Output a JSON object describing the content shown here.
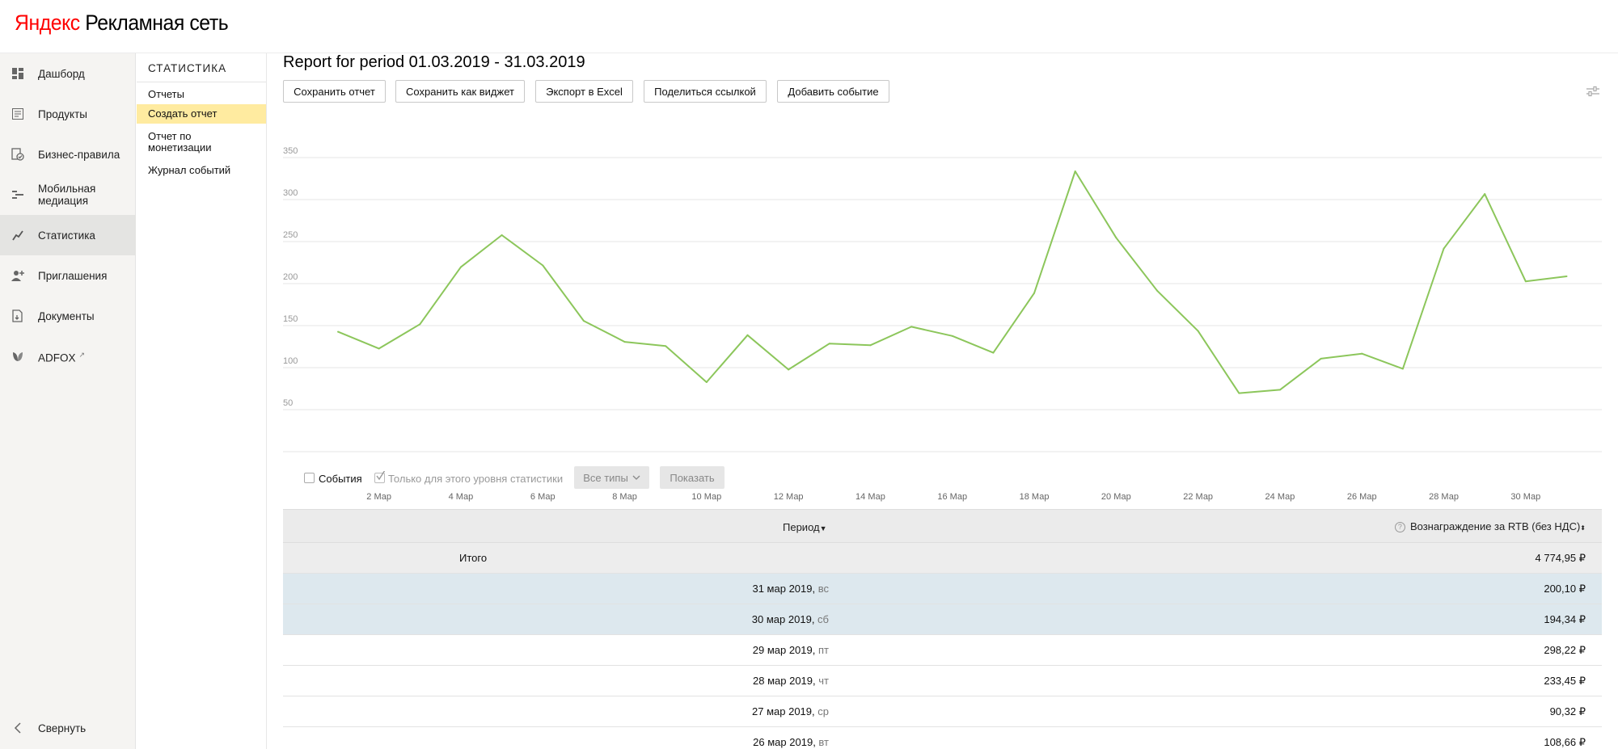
{
  "header": {
    "logo_brand": "Яндекс",
    "logo_product": "Рекламная сеть"
  },
  "sidebar": {
    "items": [
      {
        "label": "Дашборд",
        "icon": "dashboard-icon"
      },
      {
        "label": "Продукты",
        "icon": "products-icon"
      },
      {
        "label": "Бизнес-правила",
        "icon": "business-rules-icon"
      },
      {
        "label": "Мобильная медиация",
        "icon": "mediation-icon"
      },
      {
        "label": "Статистика",
        "icon": "statistics-icon",
        "active": true
      },
      {
        "label": "Приглашения",
        "icon": "invite-icon"
      },
      {
        "label": "Документы",
        "icon": "documents-icon"
      },
      {
        "label": "ADFOX",
        "icon": "adfox-icon"
      }
    ],
    "collapse_label": "Свернуть"
  },
  "subnav": {
    "title": "СТАТИСТИКА",
    "items": [
      {
        "label": "Отчеты"
      },
      {
        "label": "Создать отчет",
        "active": true
      },
      {
        "label": "Отчет по монетизации"
      },
      {
        "label": "Журнал событий"
      }
    ]
  },
  "main": {
    "title": "Report for period 01.03.2019 - 31.03.2019",
    "buttons": {
      "save": "Сохранить отчет",
      "save_widget": "Сохранить как виджет",
      "export": "Экспорт в Excel",
      "share": "Поделиться ссылкой",
      "add_event": "Добавить событие"
    }
  },
  "chart_data": {
    "type": "line",
    "x_tick_labels": [
      "2 Мар",
      "4 Мар",
      "6 Мар",
      "8 Мар",
      "10 Мар",
      "12 Мар",
      "14 Мар",
      "16 Мар",
      "18 Мар",
      "20 Мар",
      "22 Мар",
      "24 Мар",
      "26 Мар",
      "28 Мар",
      "30 Мар"
    ],
    "y_ticks": [
      50,
      100,
      150,
      200,
      250,
      300,
      350
    ],
    "ylim": [
      0,
      350
    ],
    "grid": true,
    "series": [
      {
        "color": "#8cc65b",
        "x": [
          "1 Мар",
          "2 Мар",
          "3 Мар",
          "4 Мар",
          "5 Мар",
          "6 Мар",
          "7 Мар",
          "8 Мар",
          "9 Мар",
          "10 Мар",
          "11 Мар",
          "12 Мар",
          "13 Мар",
          "14 Мар",
          "15 Мар",
          "16 Мар",
          "17 Мар",
          "18 Мар",
          "19 Мар",
          "20 Мар",
          "21 Мар",
          "22 Мар",
          "23 Мар",
          "24 Мар",
          "25 Мар",
          "26 Мар",
          "27 Мар",
          "28 Мар",
          "29 Мар",
          "30 Мар",
          "31 Мар"
        ],
        "values": [
          134,
          114,
          143,
          211,
          249,
          213,
          147,
          122,
          117,
          74,
          130,
          89,
          120,
          118,
          140,
          129,
          109,
          180,
          325,
          246,
          183,
          135,
          61,
          65,
          102,
          108,
          90,
          233,
          298,
          194,
          200
        ]
      }
    ]
  },
  "filters": {
    "events_label": "События",
    "this_level_label": "Только для этого уровня статистики",
    "types_label": "Все типы",
    "show_label": "Показать"
  },
  "table": {
    "col_period": "Период",
    "col_reward": "Вознаграждение за RTB (без НДС)",
    "total_label": "Итого",
    "total_value": "4 774,95 ₽",
    "rows": [
      {
        "date": "31 мар 2019",
        "weekday": "вс",
        "value": "200,10 ₽",
        "highlight": true
      },
      {
        "date": "30 мар 2019",
        "weekday": "сб",
        "value": "194,34 ₽",
        "highlight": true
      },
      {
        "date": "29 мар 2019",
        "weekday": "пт",
        "value": "298,22 ₽"
      },
      {
        "date": "28 мар 2019",
        "weekday": "чт",
        "value": "233,45 ₽"
      },
      {
        "date": "27 мар 2019",
        "weekday": "ср",
        "value": "90,32 ₽"
      },
      {
        "date": "26 мар 2019",
        "weekday": "вт",
        "value": "108,66 ₽"
      }
    ]
  }
}
